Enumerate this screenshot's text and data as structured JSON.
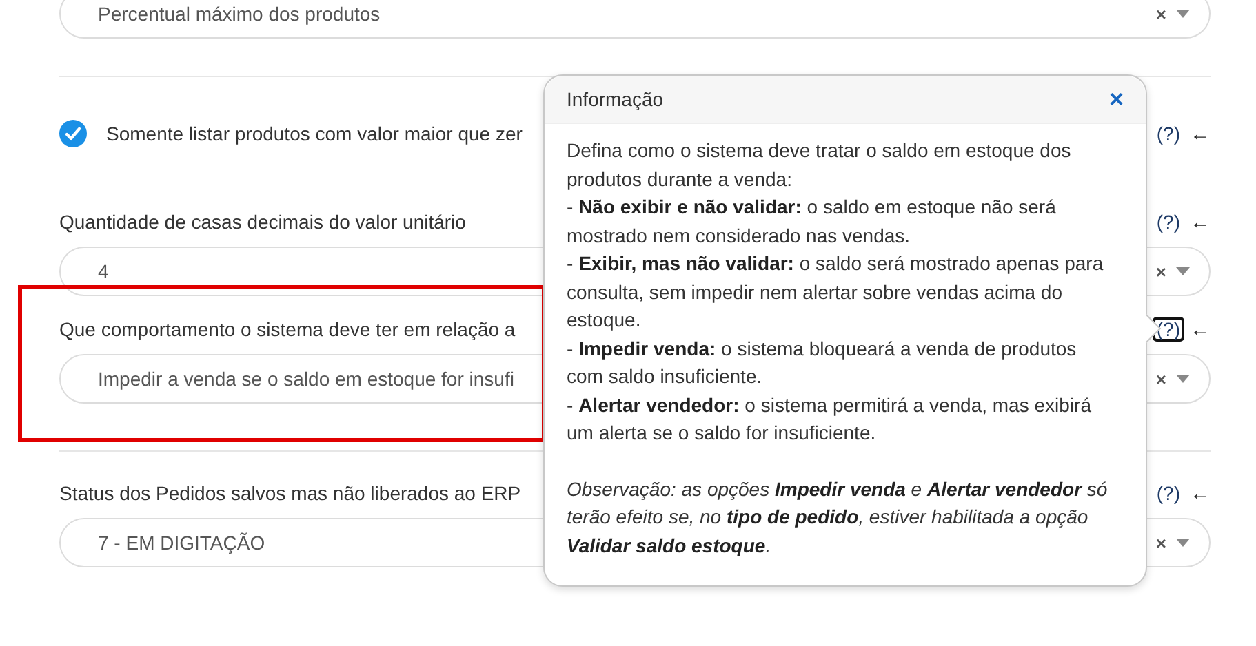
{
  "sections": [
    {
      "fields": [
        {
          "kind": "select",
          "value": "Percentual máximo dos produtos"
        }
      ]
    },
    {
      "fields": [
        {
          "kind": "checkbox",
          "label": "Somente listar produtos com valor maior que zer",
          "checked": true,
          "help": "(?)",
          "arrow": "←",
          "help_focused": false
        },
        {
          "kind": "select",
          "label": "Quantidade de casas decimais do valor unitário",
          "value": "4",
          "help": "(?)",
          "arrow": "←",
          "help_focused": false,
          "highlighted": false
        },
        {
          "kind": "select",
          "label": "Que comportamento o sistema deve ter em relação a",
          "value": "Impedir a venda se o saldo em estoque for insufi",
          "help": "(?)",
          "arrow": "←",
          "help_focused": true,
          "highlighted": true
        }
      ]
    },
    {
      "fields": [
        {
          "kind": "select",
          "label": "Status dos Pedidos salvos mas não liberados ao ERP",
          "value": "7 - EM DIGITAÇÃO",
          "help": "(?)",
          "arrow": "←",
          "help_focused": false,
          "highlighted": false
        }
      ]
    }
  ],
  "popover": {
    "title": "Informação",
    "close": "×",
    "paragraphs": [
      {
        "kind": "text",
        "text": "Defina como o sistema deve tratar o saldo em estoque dos produtos durante a venda:"
      },
      {
        "kind": "text",
        "text": "- **Não exibir e não validar:** o saldo em estoque não será mostrado nem considerado nas vendas."
      },
      {
        "kind": "text",
        "text": "- **Exibir, mas não validar:** o saldo será mostrado apenas para consulta, sem impedir nem alertar sobre vendas acima do estoque."
      },
      {
        "kind": "text",
        "text": "- **Impedir venda:** o sistema bloqueará a venda de produtos com saldo insuficiente."
      },
      {
        "kind": "text",
        "text": "- **Alertar vendedor:** o sistema permitirá a venda, mas exibirá um alerta se o saldo for insuficiente."
      },
      {
        "kind": "note",
        "text": "Observação: as opções **Impedir venda** e **Alertar vendedor** só terão efeito se, no **tipo de pedido**, estiver habilitada a opção **Validar saldo estoque**."
      }
    ]
  },
  "select_clear": "×"
}
